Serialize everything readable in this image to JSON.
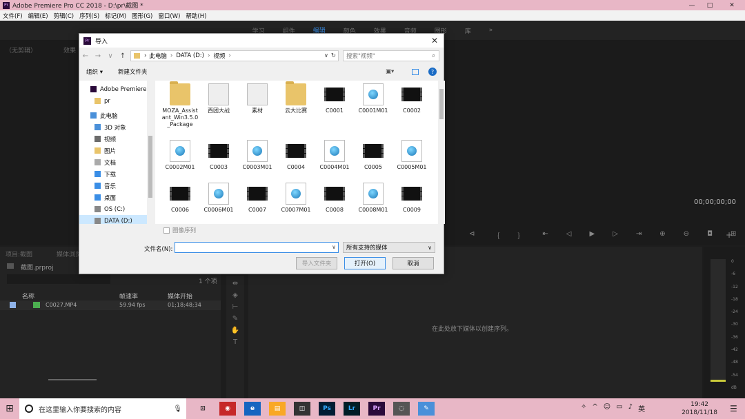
{
  "window": {
    "title": "Adobe Premiere Pro CC 2018 - D:\\pr\\截图 *",
    "min": "—",
    "max": "□",
    "close": "✕"
  },
  "menu": [
    "文件(F)",
    "编辑(E)",
    "剪辑(C)",
    "序列(S)",
    "标记(M)",
    "图形(G)",
    "窗口(W)",
    "帮助(H)"
  ],
  "workspaces": [
    {
      "label": "学习"
    },
    {
      "label": "组件"
    },
    {
      "label": "编辑",
      "active": true
    },
    {
      "label": "颜色"
    },
    {
      "label": "效果"
    },
    {
      "label": "音频"
    },
    {
      "label": "图形"
    },
    {
      "label": "库"
    },
    {
      "label": "»"
    }
  ],
  "source_panel": {
    "tab1": "（无剪辑）",
    "tab2": "效果"
  },
  "program": {
    "timecode": "00;00;00;00"
  },
  "project": {
    "tab": "项目:截图",
    "tab2": "媒体浏览",
    "file": "截图.prproj",
    "count": "1 个项",
    "col_name": "名称",
    "col_fps": "帧速率",
    "col_start": "媒体开始",
    "item": {
      "name": "C0027.MP4",
      "fps": "59.94 fps",
      "start": "01;18;48;34"
    }
  },
  "timeline": {
    "empty_text": "在此处放下媒体以创建序列。"
  },
  "meter": {
    "labels": [
      "0",
      "-6",
      "-12",
      "-18",
      "-24",
      "-30",
      "-36",
      "-42",
      "-48",
      "-54",
      "dB"
    ]
  },
  "dialog": {
    "title": "导入",
    "path": [
      "此电脑",
      "DATA (D:)",
      "视频"
    ],
    "search_placeholder": "搜索\"视频\"",
    "organize": "组织 ▾",
    "new_folder": "新建文件夹",
    "nav": [
      {
        "label": "Adobe Premiere",
        "color": "#2a0a3a"
      },
      {
        "label": "pr",
        "color": "#e9c46a",
        "indent": true
      },
      {
        "label": "此电脑",
        "color": "#4a90d9",
        "gap": true
      },
      {
        "label": "3D 对象",
        "color": "#4a90d9",
        "indent": true
      },
      {
        "label": "视频",
        "color": "#6b6b6b",
        "indent": true
      },
      {
        "label": "图片",
        "color": "#e9c46a",
        "indent": true
      },
      {
        "label": "文档",
        "color": "#aaa",
        "indent": true
      },
      {
        "label": "下载",
        "color": "#3a8ee6",
        "indent": true
      },
      {
        "label": "音乐",
        "color": "#3a8ee6",
        "indent": true
      },
      {
        "label": "桌面",
        "color": "#3a8ee6",
        "indent": true
      },
      {
        "label": "OS (C:)",
        "color": "#888",
        "indent": true
      },
      {
        "label": "DATA (D:)",
        "color": "#888",
        "indent": true,
        "selected": true
      }
    ],
    "files": [
      {
        "label": "MOZA_Assistant_Win3.5.0_Package",
        "type": "folder"
      },
      {
        "label": "西团大战",
        "type": "media"
      },
      {
        "label": "素材",
        "type": "media"
      },
      {
        "label": "云大比赛",
        "type": "folder"
      },
      {
        "label": "C0001",
        "type": "vid"
      },
      {
        "label": "C0001M01",
        "type": "doc"
      },
      {
        "label": "C0002",
        "type": "vid"
      },
      {
        "label": "C0002M01",
        "type": "doc"
      },
      {
        "label": "C0003",
        "type": "vid"
      },
      {
        "label": "C0003M01",
        "type": "doc"
      },
      {
        "label": "C0004",
        "type": "vid"
      },
      {
        "label": "C0004M01",
        "type": "doc"
      },
      {
        "label": "C0005",
        "type": "vid"
      },
      {
        "label": "C0005M01",
        "type": "doc"
      },
      {
        "label": "C0006",
        "type": "vid"
      },
      {
        "label": "C0006M01",
        "type": "doc"
      },
      {
        "label": "C0007",
        "type": "vid"
      },
      {
        "label": "C0007M01",
        "type": "doc"
      },
      {
        "label": "C0008",
        "type": "vid"
      },
      {
        "label": "C0008M01",
        "type": "doc"
      },
      {
        "label": "C0009",
        "type": "vid"
      }
    ],
    "image_sequence": "图像序列",
    "filename_label": "文件名(N):",
    "filename_value": "",
    "filetype": "所有支持的媒体",
    "import_folder": "导入文件夹",
    "open": "打开(O)",
    "cancel": "取消"
  },
  "taskbar": {
    "search": "在这里输入你要搜索的内容",
    "time": "19:42",
    "date": "2018/11/18",
    "apps": [
      "⊡",
      "◉",
      "e",
      "▤",
      "◫",
      "Ps",
      "Lr",
      "Pr",
      "◌",
      "✎"
    ],
    "tray": [
      "✧",
      "^",
      "☺",
      "▭",
      "♪",
      "英"
    ]
  }
}
